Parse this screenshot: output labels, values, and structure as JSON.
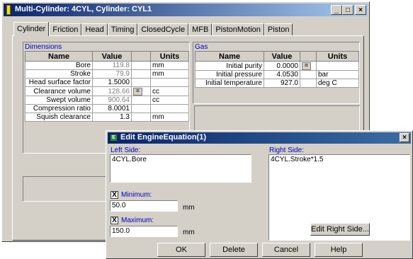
{
  "window": {
    "title": "Multi-Cylinder: 4CYL, Cylinder: CYL1",
    "controls": {
      "minimize": "_",
      "maximize": "□",
      "close": "×"
    }
  },
  "tabs": [
    "Cylinder",
    "Friction",
    "Head",
    "Timing",
    "ClosedCycle",
    "MFB",
    "PistonMotion",
    "Piston"
  ],
  "dimensions": {
    "title": "Dimensions",
    "headers": [
      "Name",
      "Value",
      "",
      "Units"
    ],
    "rows": [
      {
        "name": "Bore",
        "value": "119.8",
        "eq": "",
        "units": "mm"
      },
      {
        "name": "Stroke",
        "value": "79.9",
        "eq": "",
        "units": "mm"
      },
      {
        "name": "Head surface factor",
        "value": "1.5000",
        "eq": "",
        "units": ""
      },
      {
        "name": "Clearance volume",
        "value": "128.66",
        "eq": "=",
        "units": "cc"
      },
      {
        "name": "Swept volume",
        "value": "900.64",
        "eq": "",
        "units": "cc"
      },
      {
        "name": "Compression ratio",
        "value": "8.0001",
        "eq": "",
        "units": ""
      },
      {
        "name": "Squish clearance",
        "value": "1.3",
        "eq": "",
        "units": "mm"
      }
    ]
  },
  "gas": {
    "title": "Gas",
    "headers": [
      "Name",
      "Value",
      "",
      "Units"
    ],
    "rows": [
      {
        "name": "Initial purity",
        "value": "0.0000",
        "eq": "=",
        "units": ""
      },
      {
        "name": "Initial pressure",
        "value": "4.0530",
        "eq": "",
        "units": "bar"
      },
      {
        "name": "Initial temperature",
        "value": "927.0",
        "eq": "",
        "units": "deg C"
      }
    ]
  },
  "dialog": {
    "title": "Edit EngineEquation(1)",
    "icon": "E",
    "close": "×",
    "left_label": "Left Side:",
    "left_value": "4CYL.Bore",
    "right_label": "Right Side:",
    "right_value": "4CYL.Stroke*1.5",
    "minimum_label": "Minimum:",
    "minimum_value": "50.0",
    "minimum_checked": "X",
    "maximum_label": "Maximum:",
    "maximum_value": "150.0",
    "maximum_checked": "X",
    "unit": "mm",
    "edit_right_button": "Edit Right Side...",
    "buttons": {
      "ok": "OK",
      "delete": "Delete",
      "cancel": "Cancel",
      "help": "Help"
    }
  }
}
